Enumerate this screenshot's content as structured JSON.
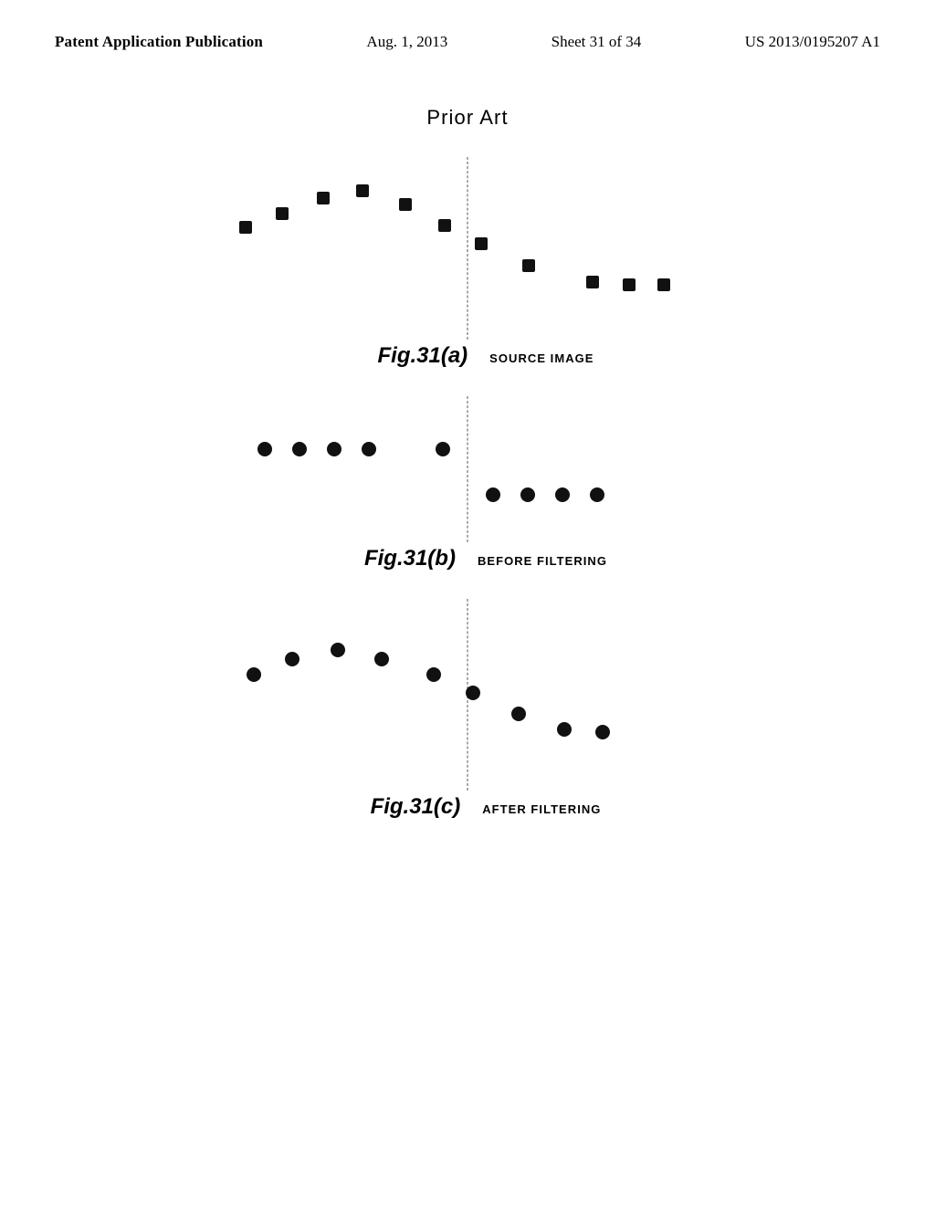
{
  "header": {
    "left_label": "Patent Application Publication",
    "center_label": "Aug. 1, 2013",
    "sheet_label": "Sheet 31 of 34",
    "patent_label": "US 2013/0195207 A1"
  },
  "prior_art": {
    "label": "Prior Art"
  },
  "figures": {
    "fig_a": {
      "label": "Fig.31(a)",
      "sublabel": "SOURCE IMAGE"
    },
    "fig_b": {
      "label": "Fig.31(b)",
      "sublabel": "BEFORE FILTERING"
    },
    "fig_c": {
      "label": "Fig.31(c)",
      "sublabel": "AFTER FILTERING"
    }
  }
}
